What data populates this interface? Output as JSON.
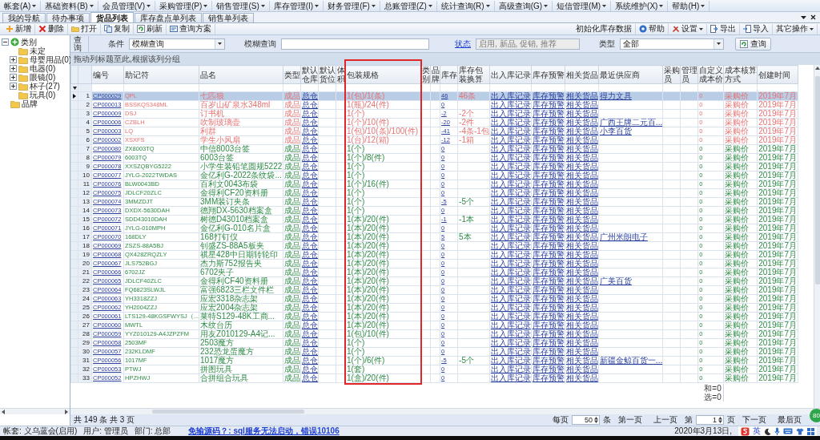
{
  "menu_bar": [
    {
      "label": "帐套(A)"
    },
    {
      "label": "基础资料(B)"
    },
    {
      "label": "会员管理(V)"
    },
    {
      "label": "采购管理(P)"
    },
    {
      "label": "销售管理(S)"
    },
    {
      "label": "库存管理(I)"
    },
    {
      "label": "财务管理(F)"
    },
    {
      "label": "总账管理(Z)"
    },
    {
      "label": "统计查询(R)"
    },
    {
      "label": "高级查询(G)"
    },
    {
      "label": "短信管理(M)"
    },
    {
      "label": "系统维护(X)"
    },
    {
      "label": "帮助(H)"
    }
  ],
  "tabs": [
    {
      "label": "我的导航",
      "selected": false
    },
    {
      "label": "待办事项",
      "selected": false
    },
    {
      "label": "货品列表",
      "selected": true
    },
    {
      "label": "库存盘点单列表",
      "selected": false
    },
    {
      "label": "销售单列表",
      "selected": false
    }
  ],
  "toolbar": {
    "left": [
      {
        "kind": "add",
        "label": "新增"
      },
      {
        "kind": "delete",
        "label": "删除"
      },
      {
        "kind": "open",
        "label": "打开"
      },
      {
        "kind": "copy",
        "label": "复制"
      },
      {
        "kind": "refresh",
        "label": "刷新"
      },
      {
        "kind": "query-plan",
        "label": "查询方案"
      }
    ],
    "right": [
      {
        "kind": "plain",
        "label": "初始化库存数据",
        "dropdown": false
      },
      {
        "kind": "help",
        "label": "帮助",
        "dropdown": false
      },
      {
        "kind": "settings",
        "label": "设置",
        "dropdown": true
      },
      {
        "kind": "export",
        "label": "导出",
        "dropdown": false
      },
      {
        "kind": "import",
        "label": "导入",
        "dropdown": false
      },
      {
        "kind": "plain",
        "label": "其它操作",
        "dropdown": true
      }
    ]
  },
  "tree": {
    "items": [
      {
        "kind": "root",
        "label": "类别",
        "expanded": true,
        "children": [
          {
            "kind": "folder",
            "label": "未定"
          },
          {
            "kind": "folder",
            "label": "母婴用品(0)",
            "expanded": false
          },
          {
            "kind": "folder",
            "label": "电器(0)",
            "expanded": false
          },
          {
            "kind": "folder",
            "label": "眼镜(0)",
            "expanded": false
          },
          {
            "kind": "folder",
            "label": "杯子(27)",
            "expanded": false
          },
          {
            "kind": "folder",
            "label": "玩具(0)"
          }
        ]
      },
      {
        "kind": "folder",
        "label": "品牌"
      }
    ]
  },
  "query": {
    "title": "查询",
    "condition_label": "条件",
    "condition_value": "模糊查询",
    "fuzzy_label": "模糊查询",
    "status_link": "状态",
    "status_value": "启用, 新品, 促销, 推荐",
    "status_disabled": true,
    "type_label": "类型",
    "type_value": "全部",
    "search_button": "查询"
  },
  "group_panel": {
    "hint": "拖动列标题至此,根据该列分组"
  },
  "table": {
    "columns": [
      {
        "label": "编号",
        "kind": "link",
        "highlighted": false
      },
      {
        "label": "助记符",
        "kind": "text",
        "highlighted": false
      },
      {
        "label": "品名",
        "kind": "text",
        "highlighted": false
      },
      {
        "label": "类型",
        "kind": "text",
        "highlighted": false
      },
      {
        "label": "默认仓库",
        "kind": "link",
        "highlighted": false
      },
      {
        "label": "默认货位",
        "highlighted": false
      },
      {
        "label": "体积",
        "highlighted": false
      },
      {
        "label": "包装规格",
        "kind": "text",
        "highlighted": true
      },
      {
        "label": "类别",
        "highlighted": false
      },
      {
        "label": "品牌",
        "highlighted": false
      },
      {
        "label": "库存",
        "kind": "link",
        "highlighted": false
      },
      {
        "label": "库存包装换算",
        "kind": "text",
        "highlighted": false
      },
      {
        "label": "出入库记录",
        "kind": "link",
        "highlighted": false
      },
      {
        "label": "库存预警",
        "kind": "link",
        "highlighted": false
      },
      {
        "label": "相关货品",
        "kind": "link",
        "highlighted": false
      },
      {
        "label": "最近供应商",
        "kind": "link",
        "highlighted": false
      },
      {
        "label": "采购员",
        "highlighted": false
      },
      {
        "label": "管理员",
        "highlighted": false
      },
      {
        "label": "自定义成本价",
        "kind": "text",
        "highlighted": false,
        "summary": [
          "和=0",
          "选=0"
        ]
      },
      {
        "label": "成本核算方式",
        "kind": "text",
        "highlighted": false
      },
      {
        "label": "创建时间",
        "kind": "text",
        "highlighted": false
      }
    ],
    "rows": [
      {
        "number": "1",
        "selected": true,
        "alert": true,
        "cells": [
          "CP000029",
          "QPL",
          "七匹狼",
          "成品",
          "总仓",
          null,
          null,
          "1(包)/1(条)",
          null,
          null,
          "46",
          "46条",
          "出入库记录",
          "库存预警",
          "相关货品",
          "得力文具",
          null,
          null,
          "0",
          "采购价",
          "2019年7月"
        ]
      },
      {
        "number": "2",
        "selected": false,
        "alert": true,
        "cells": [
          "CP000013",
          "BSSKQS348ML",
          "百岁山矿泉水348ml",
          "成品",
          "总仓",
          null,
          null,
          "1(瓶)/24(件)",
          null,
          null,
          "0",
          null,
          "出入库记录",
          "库存预警",
          "相关货品",
          null,
          null,
          null,
          "0",
          "采购价",
          "2019年7月"
        ]
      },
      {
        "number": "3",
        "selected": false,
        "alert": true,
        "cells": [
          "CP000009",
          "DSJ",
          "订书机",
          "成品",
          "总仓",
          null,
          null,
          "1(个)",
          null,
          null,
          "-2",
          "-2个",
          "出入库记录",
          "库存预警",
          "相关货品",
          null,
          null,
          null,
          "0",
          "采购价",
          "2019年7月"
        ]
      },
      {
        "number": "4",
        "selected": false,
        "alert": true,
        "cells": [
          "CP000006",
          "CZBLH",
          "吹制玻璃壶",
          "成品",
          "总仓",
          null,
          null,
          "1(个)/10(件)",
          null,
          null,
          "-20",
          "-2件",
          "出入库记录",
          "库存预警",
          "相关货品",
          "广西王牌二元百...",
          null,
          null,
          "0",
          "采购价",
          "2019年7月"
        ]
      },
      {
        "number": "5",
        "selected": false,
        "alert": true,
        "cells": [
          "CP000003",
          "LQ",
          "利群",
          "成品",
          "总仓",
          null,
          null,
          "1(包)/10(条)/100(件)",
          null,
          null,
          "-41",
          "-4条-1包",
          "出入库记录",
          "库存预警",
          "相关货品",
          "小李百货",
          null,
          null,
          "0",
          "采购价",
          "2019年7月"
        ]
      },
      {
        "number": "6",
        "selected": false,
        "alert": true,
        "cells": [
          "CP000002",
          "XSXFS",
          "学生小风扇",
          "成品",
          "总仓",
          null,
          null,
          "1(台)/12(箱)",
          null,
          null,
          "-12",
          "-1箱",
          "出入库记录",
          "库存预警",
          "相关货品",
          null,
          null,
          null,
          "0",
          "采购价",
          "2019年7月"
        ]
      },
      {
        "number": "7",
        "selected": false,
        "alert": false,
        "cells": [
          "CP000080",
          "ZX8003TQ",
          "中信8003台签",
          "成品",
          "总仓",
          null,
          null,
          "1(个)",
          null,
          null,
          "0",
          null,
          "出入库记录",
          "库存预警",
          "相关货品",
          null,
          null,
          null,
          "0",
          "采购价",
          "2019年7月"
        ]
      },
      {
        "number": "8",
        "selected": false,
        "alert": false,
        "cells": [
          "CP000079",
          "6003TQ",
          "6003台签",
          "成品",
          "总仓",
          null,
          null,
          "1(个)/8(件)",
          null,
          null,
          "0",
          null,
          "出入库记录",
          "库存预警",
          "相关货品",
          null,
          null,
          null,
          "0",
          "采购价",
          "2019年7月"
        ]
      },
      {
        "number": "9",
        "selected": false,
        "alert": false,
        "cells": [
          "CP000078",
          "XXSZQBYG5222",
          "小学生装铅笔圆规5222",
          "成品",
          "总仓",
          null,
          null,
          "1(个)",
          null,
          null,
          "0",
          null,
          "出入库记录",
          "库存预警",
          "相关货品",
          null,
          null,
          null,
          "0",
          "采购价",
          "2019年7月"
        ]
      },
      {
        "number": "10",
        "selected": false,
        "alert": false,
        "cells": [
          "CP000077",
          "JYLG-2022TWDAS",
          "金亿利G-2022条纹袋...",
          "成品",
          "总仓",
          null,
          null,
          "1(个)",
          null,
          null,
          "0",
          null,
          "出入库记录",
          "库存预警",
          "相关货品",
          null,
          null,
          null,
          "0",
          "采购价",
          "2019年7月"
        ]
      },
      {
        "number": "11",
        "selected": false,
        "alert": false,
        "cells": [
          "CP000076",
          "BLW0043BD",
          "百利文0043布袋",
          "成品",
          "总仓",
          null,
          null,
          "1(个)/16(件)",
          null,
          null,
          "0",
          null,
          "出入库记录",
          "库存预警",
          "相关货品",
          null,
          null,
          null,
          "0",
          "采购价",
          "2019年7月"
        ]
      },
      {
        "number": "12",
        "selected": false,
        "alert": false,
        "cells": [
          "CP000075",
          "JDLCF20ZLC",
          "金得利CF20资料册",
          "成品",
          "总仓",
          null,
          null,
          "1(个)",
          null,
          null,
          "0",
          null,
          "出入库记录",
          "库存预警",
          "相关货品",
          null,
          null,
          null,
          "0",
          "采购价",
          "2019年7月"
        ]
      },
      {
        "number": "13",
        "selected": false,
        "alert": false,
        "cells": [
          "CP000074",
          "3MMZDJT",
          "3MM装订夹条",
          "成品",
          "总仓",
          null,
          null,
          "1(个)",
          null,
          null,
          "-5",
          "-5个",
          "出入库记录",
          "库存预警",
          "相关货品",
          null,
          null,
          null,
          "0",
          "采购价",
          "2019年7月"
        ]
      },
      {
        "number": "14",
        "selected": false,
        "alert": false,
        "cells": [
          "CP000073",
          "DXDX-5630DAH",
          "德翔DX-5630档案盒",
          "成品",
          "总仓",
          null,
          null,
          "1(个)",
          null,
          null,
          "0",
          null,
          "出入库记录",
          "库存预警",
          "相关货品",
          null,
          null,
          null,
          "0",
          "采购价",
          "2019年7月"
        ]
      },
      {
        "number": "15",
        "selected": false,
        "alert": false,
        "cells": [
          "CP000072",
          "SDD43010DAH",
          "树德D43010档案盒",
          "成品",
          "总仓",
          null,
          null,
          "1(本)/20(件)",
          null,
          null,
          "-1",
          "-1本",
          "出入库记录",
          "库存预警",
          "相关货品",
          null,
          null,
          null,
          "0",
          "采购价",
          "2019年7月"
        ]
      },
      {
        "number": "16",
        "selected": false,
        "alert": false,
        "cells": [
          "CP000071",
          "JYLG-010MPH",
          "金亿利G-010名片盒",
          "成品",
          "总仓",
          null,
          null,
          "1(本)/20(件)",
          null,
          null,
          "0",
          null,
          "出入库记录",
          "库存预警",
          "相关货品",
          null,
          null,
          null,
          "0",
          "采购价",
          "2019年7月"
        ]
      },
      {
        "number": "17",
        "selected": false,
        "alert": false,
        "cells": [
          "CP000070",
          "168DLY",
          "168打钉仪",
          "成品",
          "总仓",
          null,
          null,
          "1(本)/20(件)",
          null,
          null,
          "5",
          "5本",
          "出入库记录",
          "库存预警",
          "相关货品",
          "广州米朗电子",
          null,
          null,
          "0",
          "采购价",
          "2019年7月"
        ]
      },
      {
        "number": "18",
        "selected": false,
        "alert": false,
        "cells": [
          "CP000069",
          "ZSZS-88A5BJ",
          "钊盛ZS-88A5板夹",
          "成品",
          "总仓",
          null,
          null,
          "1(本)/20(件)",
          null,
          null,
          "0",
          null,
          "出入库记录",
          "库存预警",
          "相关货品",
          null,
          null,
          null,
          "0",
          "采购价",
          "2019年7月"
        ]
      },
      {
        "number": "19",
        "selected": false,
        "alert": false,
        "cells": [
          "CP000068",
          "QX428ZRQZLY",
          "祺星428中日期转轮印",
          "成品",
          "总仓",
          null,
          null,
          "1(本)/20(件)",
          null,
          null,
          "0",
          null,
          "出入库记录",
          "库存预警",
          "相关货品",
          null,
          null,
          null,
          "0",
          "采购价",
          "2019年7月"
        ]
      },
      {
        "number": "20",
        "selected": false,
        "alert": false,
        "cells": [
          "CP000067",
          "JLS752BGJ",
          "杰力斯752报告夹",
          "成品",
          "总仓",
          null,
          null,
          "1(本)/20(件)",
          null,
          null,
          "0",
          null,
          "出入库记录",
          "库存预警",
          "相关货品",
          null,
          null,
          null,
          "0",
          "采购价",
          "2019年7月"
        ]
      },
      {
        "number": "21",
        "selected": false,
        "alert": false,
        "cells": [
          "CP000066",
          "6702JZ",
          "6702夹子",
          "成品",
          "总仓",
          null,
          null,
          "1(本)/20(件)",
          null,
          null,
          "0",
          null,
          "出入库记录",
          "库存预警",
          "相关货品",
          null,
          null,
          null,
          "0",
          "采购价",
          "2019年7月"
        ]
      },
      {
        "number": "22",
        "selected": false,
        "alert": false,
        "cells": [
          "CP000065",
          "JDLCF40ZLC",
          "金得利CF40资料册",
          "成品",
          "总仓",
          null,
          null,
          "1(本)/20(件)",
          null,
          null,
          "0",
          null,
          "出入库记录",
          "库存预警",
          "相关货品",
          "广美百货",
          null,
          null,
          "0",
          "采购价",
          "2019年7月"
        ]
      },
      {
        "number": "23",
        "selected": false,
        "alert": false,
        "cells": [
          "CP000064",
          "FQ6823SLWJL",
          "富强6823三栏文件栏",
          "成品",
          "总仓",
          null,
          null,
          "1(本)/20(件)",
          null,
          null,
          "0",
          null,
          "出入库记录",
          "库存预警",
          "相关货品",
          null,
          null,
          null,
          "0",
          "采购价",
          "2019年7月"
        ]
      },
      {
        "number": "24",
        "selected": false,
        "alert": false,
        "cells": [
          "CP000063",
          "YH3318ZZJ",
          "应宏3318杂志架",
          "成品",
          "总仓",
          null,
          null,
          "1(本)/20(件)",
          null,
          null,
          "0",
          null,
          "出入库记录",
          "库存预警",
          "相关货品",
          null,
          null,
          null,
          "0",
          "采购价",
          "2019年7月"
        ]
      },
      {
        "number": "25",
        "selected": false,
        "alert": false,
        "cells": [
          "CP000062",
          "YH2004ZZJ",
          "应宏2004杂志架",
          "成品",
          "总仓",
          null,
          null,
          "1(本)/20(件)",
          null,
          null,
          "0",
          null,
          "出入库记录",
          "库存预警",
          "相关货品",
          null,
          null,
          null,
          "0",
          "采购价",
          "2019年7月"
        ]
      },
      {
        "number": "26",
        "selected": false,
        "alert": false,
        "cells": [
          "CP000061",
          "LTS129-48KGSFWYSJ（...",
          "莱特S129-48K工商...",
          "成品",
          "总仓",
          null,
          null,
          "1(本)/20(件)",
          null,
          null,
          "0",
          null,
          "出入库记录",
          "库存预警",
          "相关货品",
          null,
          null,
          null,
          "0",
          "采购价",
          "2019年7月"
        ]
      },
      {
        "number": "27",
        "selected": false,
        "alert": false,
        "cells": [
          "CP000060",
          "MWTL",
          "木纹台历",
          "成品",
          "总仓",
          null,
          null,
          "1(本)/20(件)",
          null,
          null,
          "0",
          null,
          "出入库记录",
          "库存预警",
          "相关货品",
          null,
          null,
          null,
          "0",
          "采购价",
          "2019年7月"
        ]
      },
      {
        "number": "28",
        "selected": false,
        "alert": false,
        "cells": [
          "CP000059",
          "YYZ010129-A4JZPZFM",
          "用友Z010129-A4记...",
          "成品",
          "总仓",
          null,
          null,
          "1(包)/10(件)",
          null,
          null,
          "0",
          null,
          "出入库记录",
          "库存预警",
          "相关货品",
          null,
          null,
          null,
          "0",
          "采购价",
          "2019年7月"
        ]
      },
      {
        "number": "29",
        "selected": false,
        "alert": false,
        "cells": [
          "CP000058",
          "2503MF",
          "2503魔方",
          "成品",
          "总仓",
          null,
          null,
          "1(个)",
          null,
          null,
          "0",
          null,
          "出入库记录",
          "库存预警",
          "相关货品",
          null,
          null,
          null,
          "0",
          "采购价",
          "2019年7月"
        ]
      },
      {
        "number": "30",
        "selected": false,
        "alert": false,
        "cells": [
          "CP000057",
          "232KLDMF",
          "232恐龙蛋魔方",
          "成品",
          "总仓",
          null,
          null,
          "1(个)",
          null,
          null,
          "0",
          null,
          "出入库记录",
          "库存预警",
          "相关货品",
          null,
          null,
          null,
          "0",
          "采购价",
          "2019年7月"
        ]
      },
      {
        "number": "31",
        "selected": false,
        "alert": false,
        "cells": [
          "CP000056",
          "1017MF",
          "1017魔方",
          "成品",
          "总仓",
          null,
          null,
          "1(个)/6(件)",
          null,
          null,
          "-5",
          "-5个",
          "出入库记录",
          "库存预警",
          "相关货品",
          "新疆金鲸百货一...",
          null,
          null,
          "0",
          "采购价",
          "2019年7月"
        ]
      },
      {
        "number": "32",
        "selected": false,
        "alert": false,
        "cells": [
          "CP000053",
          "PTWJ",
          "拼图玩具",
          "成品",
          "总仓",
          null,
          null,
          "1(套)",
          null,
          null,
          "0",
          null,
          "出入库记录",
          "库存预警",
          "相关货品",
          null,
          null,
          null,
          "0",
          "采购价",
          "2019年7月"
        ]
      },
      {
        "number": "33",
        "selected": false,
        "alert": false,
        "cells": [
          "CP000052",
          "HPZHWJ",
          "合拼组合玩具",
          "成品",
          "总仓",
          null,
          null,
          "1(盒)/20(件)",
          null,
          null,
          "0",
          null,
          "出入库记录",
          "库存预警",
          "相关货品",
          null,
          null,
          null,
          "0",
          "采购价",
          "2019年7月"
        ]
      }
    ]
  },
  "pager": {
    "total": "共 149 条 共 3 页",
    "per_page_label": "每页",
    "per_page": "50",
    "per_page_unit": "条",
    "first": "第一页",
    "prev": "上一页",
    "page_prefix": "第",
    "page": "1",
    "page_suffix": "页",
    "next": "下一页",
    "last": "最后页"
  },
  "floating_badge": "80",
  "status_bar": {
    "account": "帐套: 义乌蓝会(启用)",
    "user": "用户: 管理员",
    "department": "部门: 总部",
    "notice": "免输源码？: sql服务无法启动，错误10106",
    "date": "2020年3月13日,",
    "ime_mode": "英"
  }
}
